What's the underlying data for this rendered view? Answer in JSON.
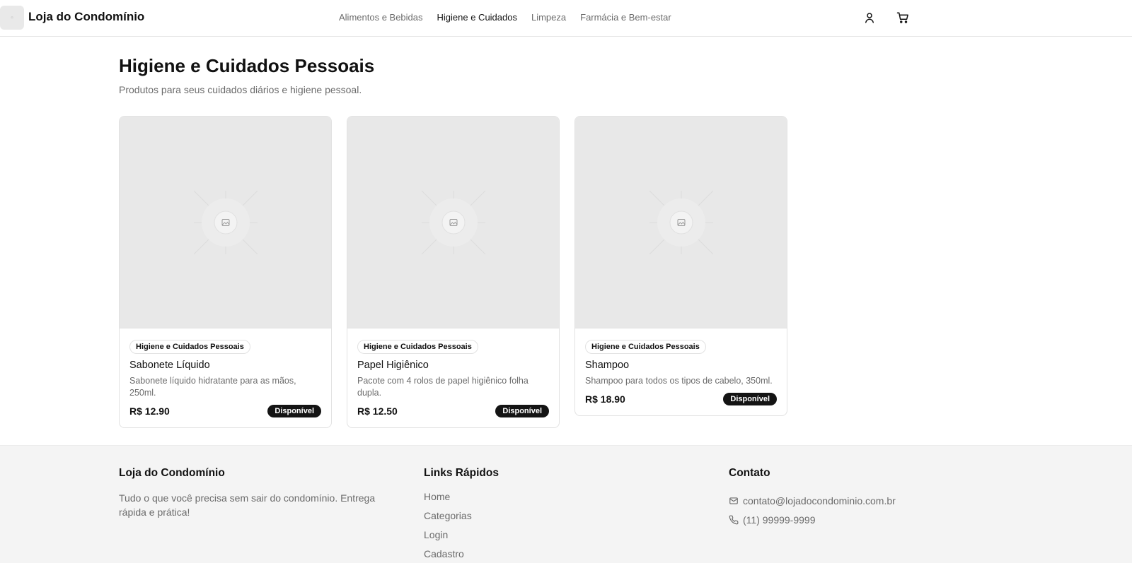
{
  "header": {
    "brand": "Loja do Condomínio",
    "nav": [
      {
        "label": "Alimentos e Bebidas",
        "active": false
      },
      {
        "label": "Higiene e Cuidados",
        "active": true
      },
      {
        "label": "Limpeza",
        "active": false
      },
      {
        "label": "Farmácia e Bem-estar",
        "active": false
      }
    ],
    "icons": [
      "user-icon",
      "cart-icon"
    ]
  },
  "main": {
    "title": "Higiene e Cuidados Pessoais",
    "subtitle": "Produtos para seus cuidados diários e higiene pessoal.",
    "products": [
      {
        "category": "Higiene e Cuidados Pessoais",
        "name": "Sabonete Líquido",
        "description": "Sabonete líquido hidratante para as mãos, 250ml.",
        "price": "R$ 12.90",
        "status": "Disponível"
      },
      {
        "category": "Higiene e Cuidados Pessoais",
        "name": "Papel Higiênico",
        "description": "Pacote com 4 rolos de papel higiênico folha dupla.",
        "price": "R$ 12.50",
        "status": "Disponível"
      },
      {
        "category": "Higiene e Cuidados Pessoais",
        "name": "Shampoo",
        "description": "Shampoo para todos os tipos de cabelo, 350ml.",
        "price": "R$ 18.90",
        "status": "Disponível"
      }
    ]
  },
  "footer": {
    "brand_title": "Loja do Condomínio",
    "brand_text": "Tudo o que você precisa sem sair do condomínio. Entrega rápida e prática!",
    "links_title": "Links Rápidos",
    "links": [
      "Home",
      "Categorias",
      "Login",
      "Cadastro"
    ],
    "contact_title": "Contato",
    "email": "contato@lojadocondominio.com.br",
    "phone": "(11) 99999-9999"
  }
}
